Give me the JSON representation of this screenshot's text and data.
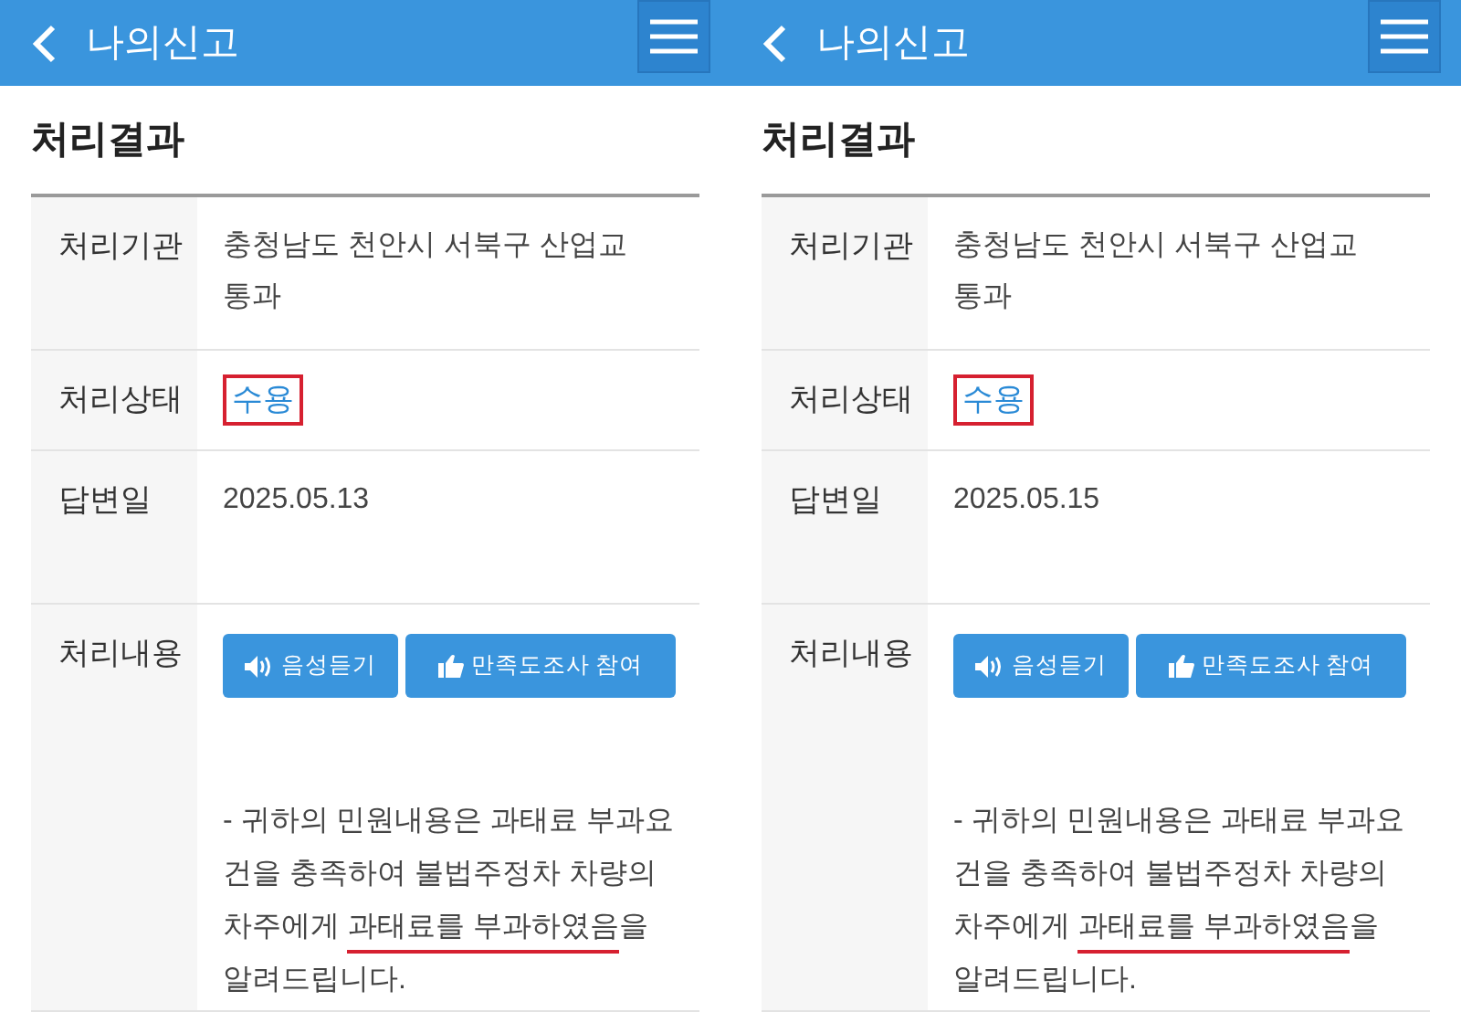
{
  "panels": [
    {
      "header": {
        "title": "나의신고"
      },
      "section_title": "처리결과",
      "rows": [
        {
          "kind": "text",
          "label": "처리기관",
          "value": "충청남도 천안시 서북구 산업교통과"
        },
        {
          "kind": "status",
          "label": "처리상태",
          "value": "수용",
          "highlighted": true
        },
        {
          "kind": "text",
          "label": "답변일",
          "value": "2025.05.13"
        },
        {
          "kind": "answer",
          "label": "처리내용",
          "buttons": [
            "음성듣기",
            "만족도조사 참여"
          ],
          "lines": [
            [
              {
                "text": "- 귀하의 민원내용은 과태료 부과요",
                "highlighted": false
              }
            ],
            [
              {
                "text": "건을 충족하여 불법주정차 차량의",
                "highlighted": false
              }
            ],
            [
              {
                "text": "차주에게 ",
                "highlighted": false
              },
              {
                "text": "과태료를 부과하였음",
                "highlighted": true
              },
              {
                "text": "을",
                "highlighted": false
              }
            ],
            [
              {
                "text": "알려드립니다.",
                "highlighted": false
              }
            ]
          ]
        }
      ]
    },
    {
      "header": {
        "title": "나의신고"
      },
      "section_title": "처리결과",
      "rows": [
        {
          "kind": "text",
          "label": "처리기관",
          "value": "충청남도 천안시 서북구 산업교통과"
        },
        {
          "kind": "status",
          "label": "처리상태",
          "value": "수용",
          "highlighted": true
        },
        {
          "kind": "text",
          "label": "답변일",
          "value": "2025.05.15"
        },
        {
          "kind": "answer",
          "label": "처리내용",
          "buttons": [
            "음성듣기",
            "만족도조사 참여"
          ],
          "lines": [
            [
              {
                "text": "- 귀하의 민원내용은 과태료 부과요",
                "highlighted": false
              }
            ],
            [
              {
                "text": "건을 충족하여 불법주정차 차량의",
                "highlighted": false
              }
            ],
            [
              {
                "text": "차주에게 ",
                "highlighted": false
              },
              {
                "text": "과태료를 부과하였음",
                "highlighted": true
              },
              {
                "text": "을",
                "highlighted": false
              }
            ],
            [
              {
                "text": "알려드립니다.",
                "highlighted": false
              }
            ]
          ]
        }
      ]
    }
  ]
}
